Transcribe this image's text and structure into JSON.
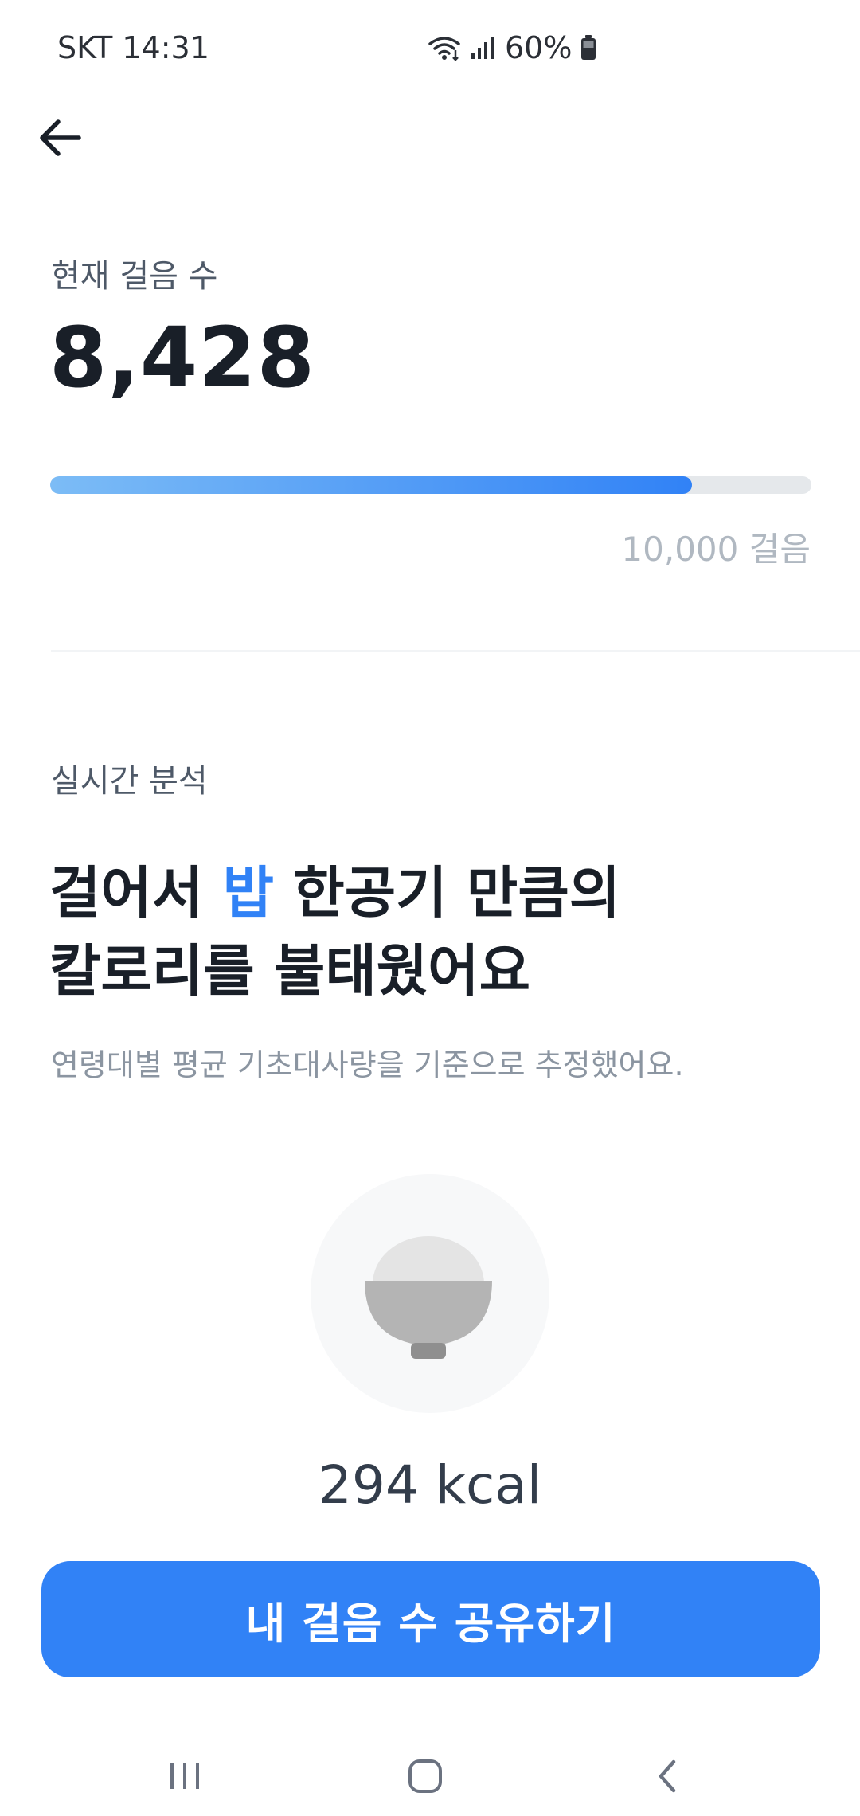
{
  "status_bar": {
    "carrier_time": "SKT 14:31",
    "battery": "60%"
  },
  "steps": {
    "label": "현재 걸음 수",
    "count": "8,428",
    "progress_fraction": 0.8428,
    "goal": "10,000 걸음"
  },
  "analysis": {
    "section_label": "실시간 분석",
    "headline_prefix": "걸어서 ",
    "headline_accent": "밥",
    "headline_suffix_line1": " 한공기 만큼의",
    "headline_line2": "칼로리를 불태웠어요",
    "subtext": "연령대별 평균 기초대사량을 기준으로 추정했어요.",
    "food_icon": "rice-bowl-icon",
    "kcal": "294 kcal"
  },
  "share_button": {
    "label": "내 걸음 수 공유하기"
  },
  "colors": {
    "accent": "#3182f6",
    "progress_start": "#7cbcf6",
    "track": "#e5e8eb",
    "text_primary": "#191f28",
    "text_muted": "#8b95a1"
  },
  "icons": {
    "back": "arrow-left-icon",
    "wifi": "wifi-icon",
    "signal": "signal-icon",
    "battery": "battery-icon",
    "nav_recent": "recent-apps-icon",
    "nav_home": "home-icon",
    "nav_back": "nav-back-icon"
  }
}
